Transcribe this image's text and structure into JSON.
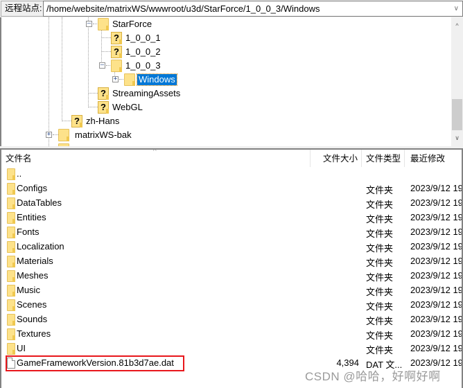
{
  "address_bar": {
    "label": "远程站点:",
    "path": "/home/website/matrixWS/wwwroot/u3d/StarForce/1_0_0_3/Windows",
    "dropdown_icon": "chevron-down-icon"
  },
  "tree": {
    "nodes": [
      {
        "label": "StarForce",
        "icon": "folder-icon",
        "expander": "collapse"
      },
      {
        "label": "1_0_0_1",
        "icon": "unknown-folder-icon"
      },
      {
        "label": "1_0_0_2",
        "icon": "unknown-folder-icon"
      },
      {
        "label": "1_0_0_3",
        "icon": "folder-icon",
        "expander": "collapse"
      },
      {
        "label": "Windows",
        "icon": "folder-icon",
        "expander": "expand",
        "selected": true
      },
      {
        "label": "StreamingAssets",
        "icon": "unknown-folder-icon"
      },
      {
        "label": "WebGL",
        "icon": "unknown-folder-icon"
      },
      {
        "label": "zh-Hans",
        "icon": "unknown-folder-icon"
      },
      {
        "label": "matrixWS-bak",
        "icon": "folder-icon",
        "expander": "expand"
      }
    ]
  },
  "file_list": {
    "columns": [
      "文件名",
      "文件大小",
      "文件类型",
      "最近修改"
    ],
    "rows": [
      {
        "name": "..",
        "size": "",
        "type": "",
        "modified": "",
        "icon": "folder-icon"
      },
      {
        "name": "Configs",
        "size": "",
        "type": "文件夹",
        "modified": "2023/9/12 19",
        "icon": "folder-icon"
      },
      {
        "name": "DataTables",
        "size": "",
        "type": "文件夹",
        "modified": "2023/9/12 19",
        "icon": "folder-icon"
      },
      {
        "name": "Entities",
        "size": "",
        "type": "文件夹",
        "modified": "2023/9/12 19",
        "icon": "folder-icon"
      },
      {
        "name": "Fonts",
        "size": "",
        "type": "文件夹",
        "modified": "2023/9/12 19",
        "icon": "folder-icon"
      },
      {
        "name": "Localization",
        "size": "",
        "type": "文件夹",
        "modified": "2023/9/12 19",
        "icon": "folder-icon"
      },
      {
        "name": "Materials",
        "size": "",
        "type": "文件夹",
        "modified": "2023/9/12 19",
        "icon": "folder-icon"
      },
      {
        "name": "Meshes",
        "size": "",
        "type": "文件夹",
        "modified": "2023/9/12 19",
        "icon": "folder-icon"
      },
      {
        "name": "Music",
        "size": "",
        "type": "文件夹",
        "modified": "2023/9/12 19",
        "icon": "folder-icon"
      },
      {
        "name": "Scenes",
        "size": "",
        "type": "文件夹",
        "modified": "2023/9/12 19",
        "icon": "folder-icon"
      },
      {
        "name": "Sounds",
        "size": "",
        "type": "文件夹",
        "modified": "2023/9/12 19",
        "icon": "folder-icon"
      },
      {
        "name": "Textures",
        "size": "",
        "type": "文件夹",
        "modified": "2023/9/12 19",
        "icon": "folder-icon"
      },
      {
        "name": "UI",
        "size": "",
        "type": "文件夹",
        "modified": "2023/9/12 19",
        "icon": "folder-icon"
      },
      {
        "name": "GameFrameworkVersion.81b3d7ae.dat",
        "size": "4,394",
        "type": "DAT 文...",
        "modified": "2023/9/12 19",
        "icon": "file-icon",
        "highlighted": true
      }
    ]
  },
  "highlight_color": "#e8161b",
  "selection_color": "#0078d7",
  "watermark": "CSDN @哈哈，好啊好啊"
}
